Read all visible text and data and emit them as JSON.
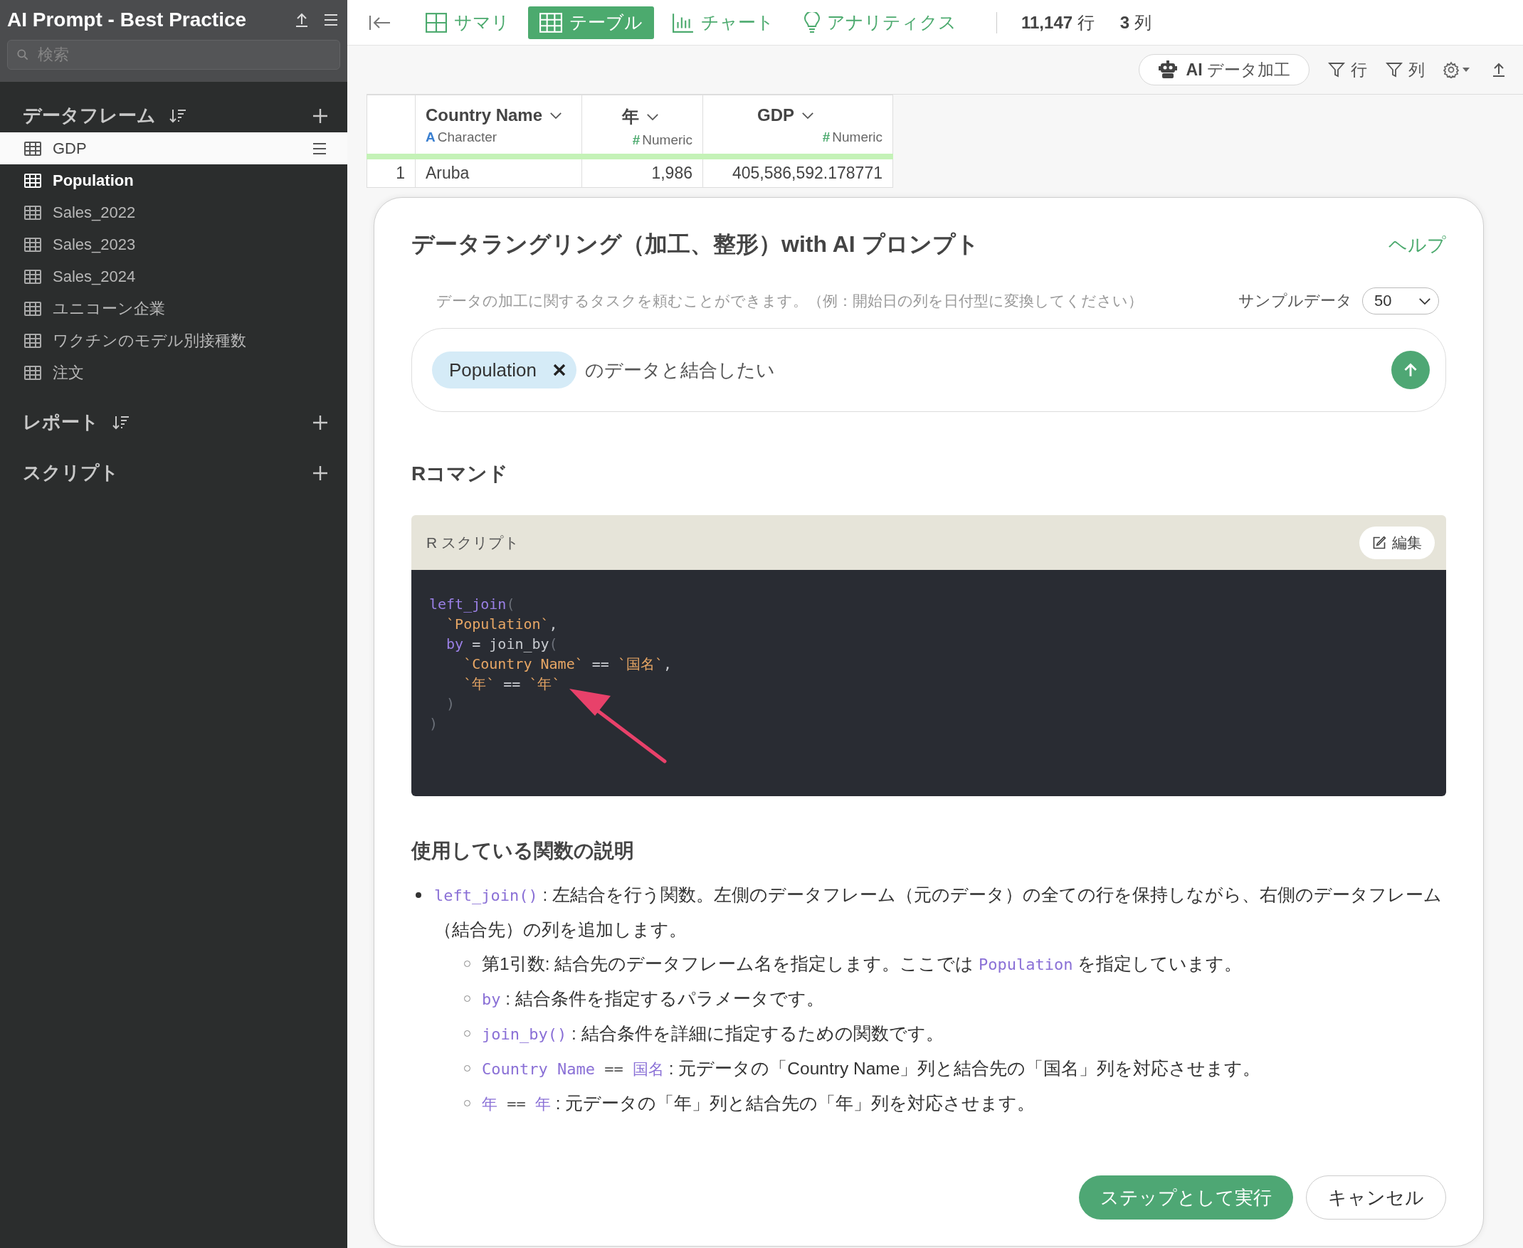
{
  "sidebar": {
    "title": "AI Prompt - Best Practice",
    "search": {
      "placeholder": "検索"
    },
    "sections": [
      {
        "title": "データフレーム",
        "sortable": true,
        "items": [
          {
            "label": "GDP",
            "selected": true,
            "current": false
          },
          {
            "label": "Population",
            "selected": false,
            "current": true
          },
          {
            "label": "Sales_2022",
            "selected": false,
            "current": false
          },
          {
            "label": "Sales_2023",
            "selected": false,
            "current": false
          },
          {
            "label": "Sales_2024",
            "selected": false,
            "current": false
          },
          {
            "label": "ユニコーン企業",
            "selected": false,
            "current": false
          },
          {
            "label": "ワクチンのモデル別接種数",
            "selected": false,
            "current": false
          },
          {
            "label": "注文",
            "selected": false,
            "current": false
          }
        ]
      },
      {
        "title": "レポート",
        "sortable": true
      },
      {
        "title": "スクリプト",
        "sortable": false
      }
    ]
  },
  "topbar": {
    "tabs": [
      {
        "label": "サマリ",
        "kind": "summary",
        "selected": false
      },
      {
        "label": "テーブル",
        "kind": "table",
        "selected": true
      },
      {
        "label": "チャート",
        "kind": "chart",
        "selected": false
      },
      {
        "label": "アナリティクス",
        "kind": "analytics",
        "selected": false
      }
    ],
    "row_count": "11,147",
    "row_unit": "行",
    "column_count": "3",
    "column_unit": "列"
  },
  "toolbar": {
    "ai_button": "**AI** データ加工",
    "row_filter": "行",
    "column_filter": "列"
  },
  "table": {
    "columns": [
      {
        "name": "Country Name",
        "type": "Character",
        "type_symbol": "A",
        "kind": "character"
      },
      {
        "name": "年",
        "type": "Numeric",
        "type_symbol": "#",
        "kind": "numeric"
      },
      {
        "name": "GDP",
        "type": "Numeric",
        "type_symbol": "#",
        "kind": "numeric"
      }
    ],
    "rows": [
      {
        "index": "1",
        "cells": [
          "Aruba",
          "1,986",
          "405,586,592.178771"
        ]
      }
    ]
  },
  "dialog": {
    "title": "データラングリング（加工、整形）with AI プロンプト",
    "help_link": "ヘルプ",
    "hint": "データの加工に関するタスクを頼むことができます。（例：開始日の列を日付型に変換してください）",
    "sample_label": "サンプルデータ",
    "sample_value": "50",
    "prompt": {
      "chip": "Population",
      "text": "のデータと結合したい"
    },
    "command_heading": "Rコマンド",
    "script": {
      "title": "R スクリプト",
      "edit_button": "編集",
      "lines": [
        {
          "tokens": [
            {
              "kind": "fn",
              "text": "left_join"
            },
            {
              "kind": "punct",
              "text": "("
            }
          ],
          "children": [
            {
              "tokens": [
                {
                  "kind": "str",
                  "text": "`Population`"
                },
                {
                  "kind": "plain",
                  "text": ","
                }
              ]
            },
            {
              "tokens": [
                {
                  "kind": "fn",
                  "text": "by"
                },
                {
                  "kind": "plain",
                  "text": " = join_by"
                },
                {
                  "kind": "punct",
                  "text": "("
                }
              ],
              "children": [
                {
                  "tokens": [
                    {
                      "kind": "str",
                      "text": "`Country Name`"
                    },
                    {
                      "kind": "plain",
                      "text": " == "
                    },
                    {
                      "kind": "str",
                      "text": "`国名`"
                    },
                    {
                      "kind": "plain",
                      "text": ","
                    }
                  ]
                },
                {
                  "tokens": [
                    {
                      "kind": "str",
                      "text": "`年`"
                    },
                    {
                      "kind": "plain",
                      "text": " == "
                    },
                    {
                      "kind": "str",
                      "text": "`年`"
                    }
                  ]
                }
              ]
            },
            {
              "tokens": [
                {
                  "kind": "punct",
                  "text": ")"
                }
              ]
            }
          ]
        },
        {
          "tokens": [
            {
              "kind": "punct",
              "text": ")"
            }
          ]
        }
      ]
    },
    "explanation_heading": "使用している関数の説明",
    "bullets": [
      {
        "segments": [
          {
            "kind": "code",
            "text": "left_join()"
          },
          {
            "kind": "text",
            "text": " : 左結合を行う関数。左側のデータフレーム（元のデータ）の全ての行を保持しながら、右側のデータフレーム（結合先）の列を追加します。"
          }
        ],
        "children": [
          {
            "segments": [
              {
                "kind": "text",
                "text": "第1引数: 結合先のデータフレーム名を指定します。ここでは "
              },
              {
                "kind": "code",
                "text": "Population"
              },
              {
                "kind": "text",
                "text": " を指定しています。"
              }
            ]
          },
          {
            "segments": [
              {
                "kind": "code",
                "text": "by"
              },
              {
                "kind": "text",
                "text": " : 結合条件を指定するパラメータです。"
              }
            ]
          },
          {
            "segments": [
              {
                "kind": "code",
                "text": "join_by()"
              },
              {
                "kind": "text",
                "text": " : 結合条件を詳細に指定するための関数です。"
              }
            ]
          },
          {
            "segments": [
              {
                "kind": "code",
                "text": "Country Name"
              },
              {
                "kind": "op",
                "text": " == "
              },
              {
                "kind": "code",
                "text": "国名"
              },
              {
                "kind": "text",
                "text": " : 元データの「Country Name」列と結合先の「国名」列を対応させます。"
              }
            ]
          },
          {
            "segments": [
              {
                "kind": "code",
                "text": "年"
              },
              {
                "kind": "op",
                "text": " == "
              },
              {
                "kind": "code",
                "text": "年"
              },
              {
                "kind": "text",
                "text": " : 元データの「年」列と結合先の「年」列を対応させます。"
              }
            ]
          }
        ]
      }
    ],
    "buttons": [
      {
        "label": "ステップとして実行",
        "kind": "primary"
      },
      {
        "label": "キャンセル",
        "kind": "secondary"
      }
    ]
  }
}
